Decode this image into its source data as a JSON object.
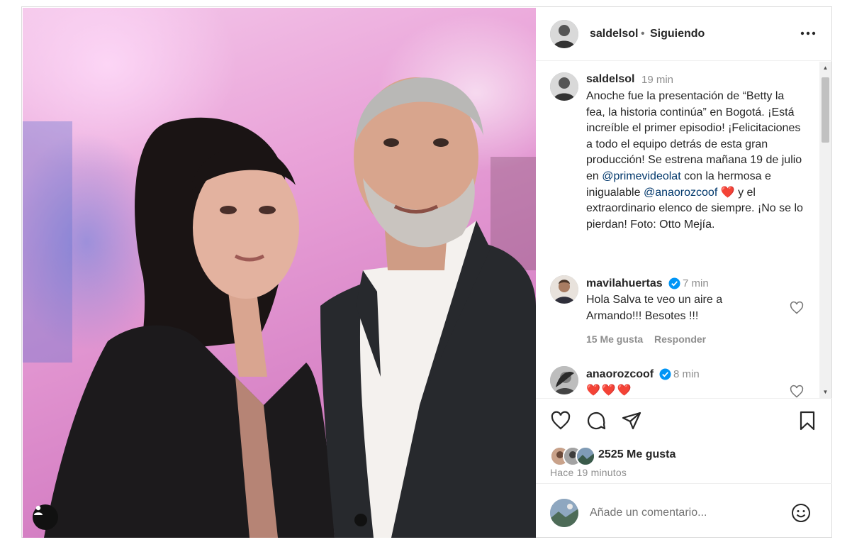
{
  "header": {
    "username": "saldelsol",
    "separator": "•",
    "follow_status": "Siguiendo",
    "more_icon": "more-horizontal-icon"
  },
  "caption": {
    "username": "saldelsol",
    "time": "19 min",
    "text_parts": {
      "p1": "Anoche fue la presentación de “Betty la fea, la historia continúa” en Bogotá. ¡Está increíble el primer episodio! ¡Felicitaciones a todo el equipo detrás de esta gran producción! Se estrena mañana 19 de julio en ",
      "mention1": "@primevideolat",
      "p2": " con la hermosa e inigualable ",
      "mention2": "@anaorozcoof",
      "heart": "❤️",
      "p3": "  y el extraordinario elenco de siempre. ¡No se lo pierdan! Foto: Otto Mejía."
    }
  },
  "comments": [
    {
      "username": "mavilahuertas",
      "verified": true,
      "time": "7 min",
      "text": "Hola Salva te veo un aire a Armando!!! Besotes !!!",
      "likes": "15 Me gusta",
      "reply_label": "Responder"
    },
    {
      "username": "anaorozcoof",
      "verified": true,
      "time": "8 min",
      "text": "❤️❤️❤️"
    }
  ],
  "actions": {
    "like_icon": "heart-icon",
    "comment_icon": "comment-icon",
    "share_icon": "send-icon",
    "save_icon": "bookmark-icon",
    "likes_count": "2525 Me gusta",
    "posted_time": "Hace 19 minutos"
  },
  "comment_box": {
    "placeholder": "Añade un comentario...",
    "emoji_icon": "emoji-icon"
  },
  "colors": {
    "link": "#00376b",
    "muted": "#8e8e8e",
    "verified": "#0095f6",
    "heart_red": "#ff3040"
  }
}
